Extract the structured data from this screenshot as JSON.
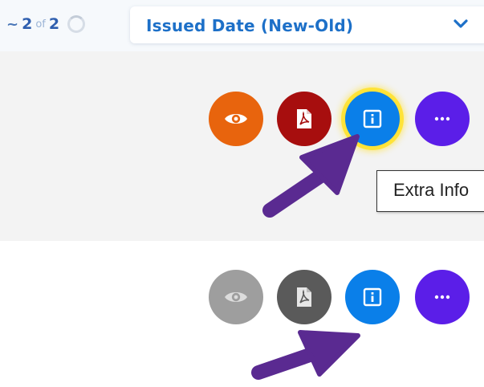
{
  "toolbar": {
    "pager": {
      "prefix": "~",
      "current": "2",
      "of": "of",
      "total": "2"
    },
    "sort": {
      "selected": "Issued Date (New-Old)"
    }
  },
  "colors": {
    "view_active": "#e8640d",
    "pdf_active": "#a70e0e",
    "info": "#0a7fe9",
    "info_highlight": "#ffe338",
    "more": "#5b1ee8",
    "view_disabled": "#9e9e9e",
    "pdf_disabled": "#5a5a5a",
    "annotation_arrow": "#5a2a91"
  },
  "rows": [
    {
      "actions": [
        {
          "name": "view",
          "icon": "eye-icon",
          "state": "active"
        },
        {
          "name": "pdf",
          "icon": "pdf-icon",
          "state": "active"
        },
        {
          "name": "extra-info",
          "icon": "info-icon",
          "state": "highlighted"
        },
        {
          "name": "more",
          "icon": "ellipsis-icon",
          "state": "active"
        }
      ],
      "tooltip": "Extra Info"
    },
    {
      "actions": [
        {
          "name": "view",
          "icon": "eye-icon",
          "state": "disabled"
        },
        {
          "name": "pdf",
          "icon": "pdf-icon",
          "state": "disabled"
        },
        {
          "name": "extra-info",
          "icon": "info-icon",
          "state": "active"
        },
        {
          "name": "more",
          "icon": "ellipsis-icon",
          "state": "active"
        }
      ]
    }
  ]
}
